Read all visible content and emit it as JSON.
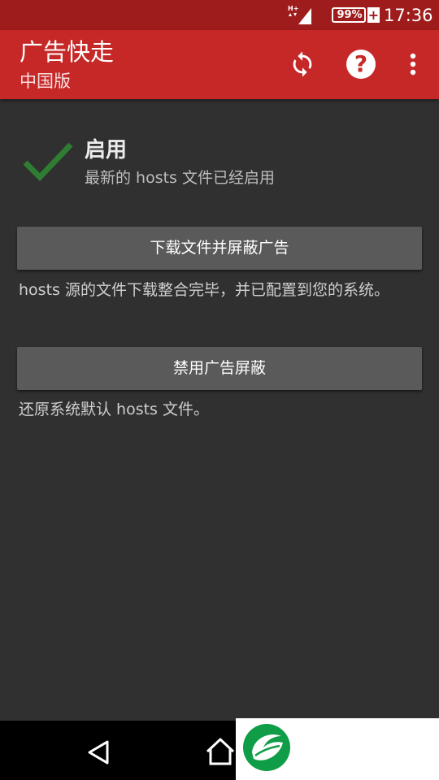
{
  "status_bar": {
    "signal_label": "H+",
    "battery_percent": "99%",
    "charging_symbol": "+",
    "time": "17:36"
  },
  "app_bar": {
    "title": "广告快走",
    "subtitle": "中国版",
    "icons": [
      "refresh-icon",
      "help-icon",
      "more-vert-icon"
    ]
  },
  "status": {
    "title": "启用",
    "description": "最新的 hosts 文件已经启用",
    "icon": "checkmark-icon",
    "icon_color": "#2e7d32"
  },
  "actions": [
    {
      "label": "下载文件并屏蔽广告",
      "description": "hosts 源的文件下载整合完毕，并已配置到您的系统。"
    },
    {
      "label": "禁用广告屏蔽",
      "description": "还原系统默认 hosts 文件。"
    }
  ],
  "nav_bar": {
    "icons": [
      "back-icon",
      "home-icon"
    ]
  },
  "colors": {
    "status_bar": "#9f1c1c",
    "app_bar": "#c62828",
    "background": "#303030",
    "button": "#5a5a5a"
  }
}
